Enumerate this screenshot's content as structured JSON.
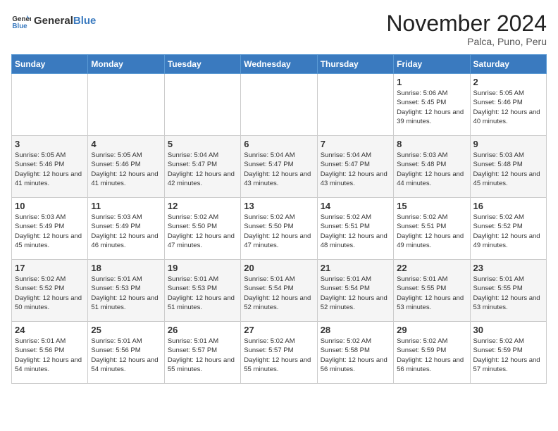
{
  "header": {
    "logo_general": "General",
    "logo_blue": "Blue",
    "title": "November 2024",
    "subtitle": "Palca, Puno, Peru"
  },
  "weekdays": [
    "Sunday",
    "Monday",
    "Tuesday",
    "Wednesday",
    "Thursday",
    "Friday",
    "Saturday"
  ],
  "weeks": [
    [
      null,
      null,
      null,
      null,
      null,
      {
        "day": "1",
        "sunrise": "5:06 AM",
        "sunset": "5:45 PM",
        "daylight": "12 hours and 39 minutes."
      },
      {
        "day": "2",
        "sunrise": "5:05 AM",
        "sunset": "5:46 PM",
        "daylight": "12 hours and 40 minutes."
      }
    ],
    [
      {
        "day": "3",
        "sunrise": "5:05 AM",
        "sunset": "5:46 PM",
        "daylight": "12 hours and 41 minutes."
      },
      {
        "day": "4",
        "sunrise": "5:05 AM",
        "sunset": "5:46 PM",
        "daylight": "12 hours and 41 minutes."
      },
      {
        "day": "5",
        "sunrise": "5:04 AM",
        "sunset": "5:47 PM",
        "daylight": "12 hours and 42 minutes."
      },
      {
        "day": "6",
        "sunrise": "5:04 AM",
        "sunset": "5:47 PM",
        "daylight": "12 hours and 43 minutes."
      },
      {
        "day": "7",
        "sunrise": "5:04 AM",
        "sunset": "5:47 PM",
        "daylight": "12 hours and 43 minutes."
      },
      {
        "day": "8",
        "sunrise": "5:03 AM",
        "sunset": "5:48 PM",
        "daylight": "12 hours and 44 minutes."
      },
      {
        "day": "9",
        "sunrise": "5:03 AM",
        "sunset": "5:48 PM",
        "daylight": "12 hours and 45 minutes."
      }
    ],
    [
      {
        "day": "10",
        "sunrise": "5:03 AM",
        "sunset": "5:49 PM",
        "daylight": "12 hours and 45 minutes."
      },
      {
        "day": "11",
        "sunrise": "5:03 AM",
        "sunset": "5:49 PM",
        "daylight": "12 hours and 46 minutes."
      },
      {
        "day": "12",
        "sunrise": "5:02 AM",
        "sunset": "5:50 PM",
        "daylight": "12 hours and 47 minutes."
      },
      {
        "day": "13",
        "sunrise": "5:02 AM",
        "sunset": "5:50 PM",
        "daylight": "12 hours and 47 minutes."
      },
      {
        "day": "14",
        "sunrise": "5:02 AM",
        "sunset": "5:51 PM",
        "daylight": "12 hours and 48 minutes."
      },
      {
        "day": "15",
        "sunrise": "5:02 AM",
        "sunset": "5:51 PM",
        "daylight": "12 hours and 49 minutes."
      },
      {
        "day": "16",
        "sunrise": "5:02 AM",
        "sunset": "5:52 PM",
        "daylight": "12 hours and 49 minutes."
      }
    ],
    [
      {
        "day": "17",
        "sunrise": "5:02 AM",
        "sunset": "5:52 PM",
        "daylight": "12 hours and 50 minutes."
      },
      {
        "day": "18",
        "sunrise": "5:01 AM",
        "sunset": "5:53 PM",
        "daylight": "12 hours and 51 minutes."
      },
      {
        "day": "19",
        "sunrise": "5:01 AM",
        "sunset": "5:53 PM",
        "daylight": "12 hours and 51 minutes."
      },
      {
        "day": "20",
        "sunrise": "5:01 AM",
        "sunset": "5:54 PM",
        "daylight": "12 hours and 52 minutes."
      },
      {
        "day": "21",
        "sunrise": "5:01 AM",
        "sunset": "5:54 PM",
        "daylight": "12 hours and 52 minutes."
      },
      {
        "day": "22",
        "sunrise": "5:01 AM",
        "sunset": "5:55 PM",
        "daylight": "12 hours and 53 minutes."
      },
      {
        "day": "23",
        "sunrise": "5:01 AM",
        "sunset": "5:55 PM",
        "daylight": "12 hours and 53 minutes."
      }
    ],
    [
      {
        "day": "24",
        "sunrise": "5:01 AM",
        "sunset": "5:56 PM",
        "daylight": "12 hours and 54 minutes."
      },
      {
        "day": "25",
        "sunrise": "5:01 AM",
        "sunset": "5:56 PM",
        "daylight": "12 hours and 54 minutes."
      },
      {
        "day": "26",
        "sunrise": "5:01 AM",
        "sunset": "5:57 PM",
        "daylight": "12 hours and 55 minutes."
      },
      {
        "day": "27",
        "sunrise": "5:02 AM",
        "sunset": "5:57 PM",
        "daylight": "12 hours and 55 minutes."
      },
      {
        "day": "28",
        "sunrise": "5:02 AM",
        "sunset": "5:58 PM",
        "daylight": "12 hours and 56 minutes."
      },
      {
        "day": "29",
        "sunrise": "5:02 AM",
        "sunset": "5:59 PM",
        "daylight": "12 hours and 56 minutes."
      },
      {
        "day": "30",
        "sunrise": "5:02 AM",
        "sunset": "5:59 PM",
        "daylight": "12 hours and 57 minutes."
      }
    ]
  ]
}
